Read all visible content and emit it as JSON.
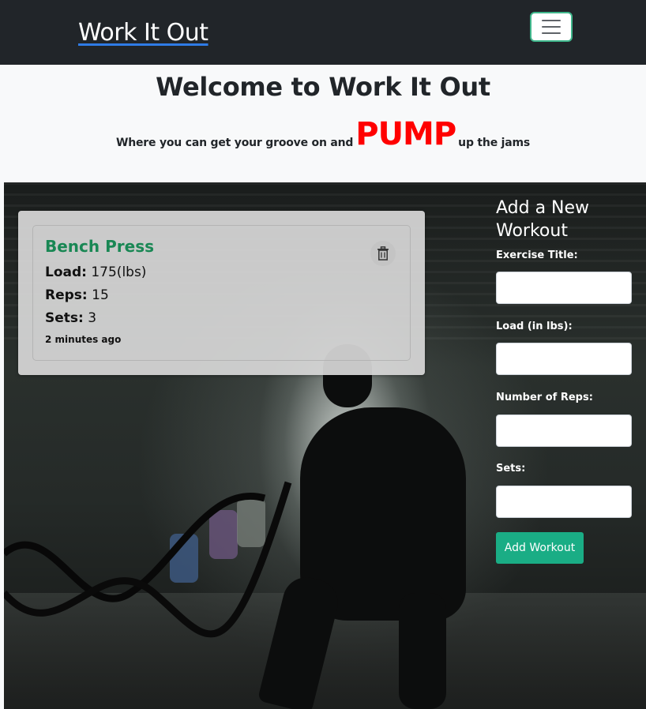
{
  "navbar": {
    "brand": "Work It Out",
    "toggle_icon": "hamburger-menu-icon"
  },
  "hero": {
    "title": "Welcome to Work It Out",
    "tagline_before": "Where you can get your groove on and",
    "tagline_highlight": "PUMP",
    "tagline_after": "up the jams",
    "highlight_color": "#ff0000"
  },
  "workouts": [
    {
      "title": "Bench Press",
      "load_label": "Load:",
      "load_value": "175(lbs)",
      "reps_label": "Reps:",
      "reps_value": "15",
      "sets_label": "Sets:",
      "sets_value": "3",
      "time_ago": "2 minutes ago",
      "delete_icon": "trash-icon"
    }
  ],
  "form": {
    "title": "Add a New Workout",
    "fields": [
      {
        "label": "Exercise Title:",
        "value": ""
      },
      {
        "label": "Load (in lbs):",
        "value": ""
      },
      {
        "label": "Number of Reps:",
        "value": ""
      },
      {
        "label": "Sets:",
        "value": ""
      }
    ],
    "submit_label": "Add Workout"
  },
  "colors": {
    "navbar": "#212529",
    "accent_green": "#198754",
    "button_green": "#1aad85",
    "toggler_border": "#3fb68b"
  }
}
